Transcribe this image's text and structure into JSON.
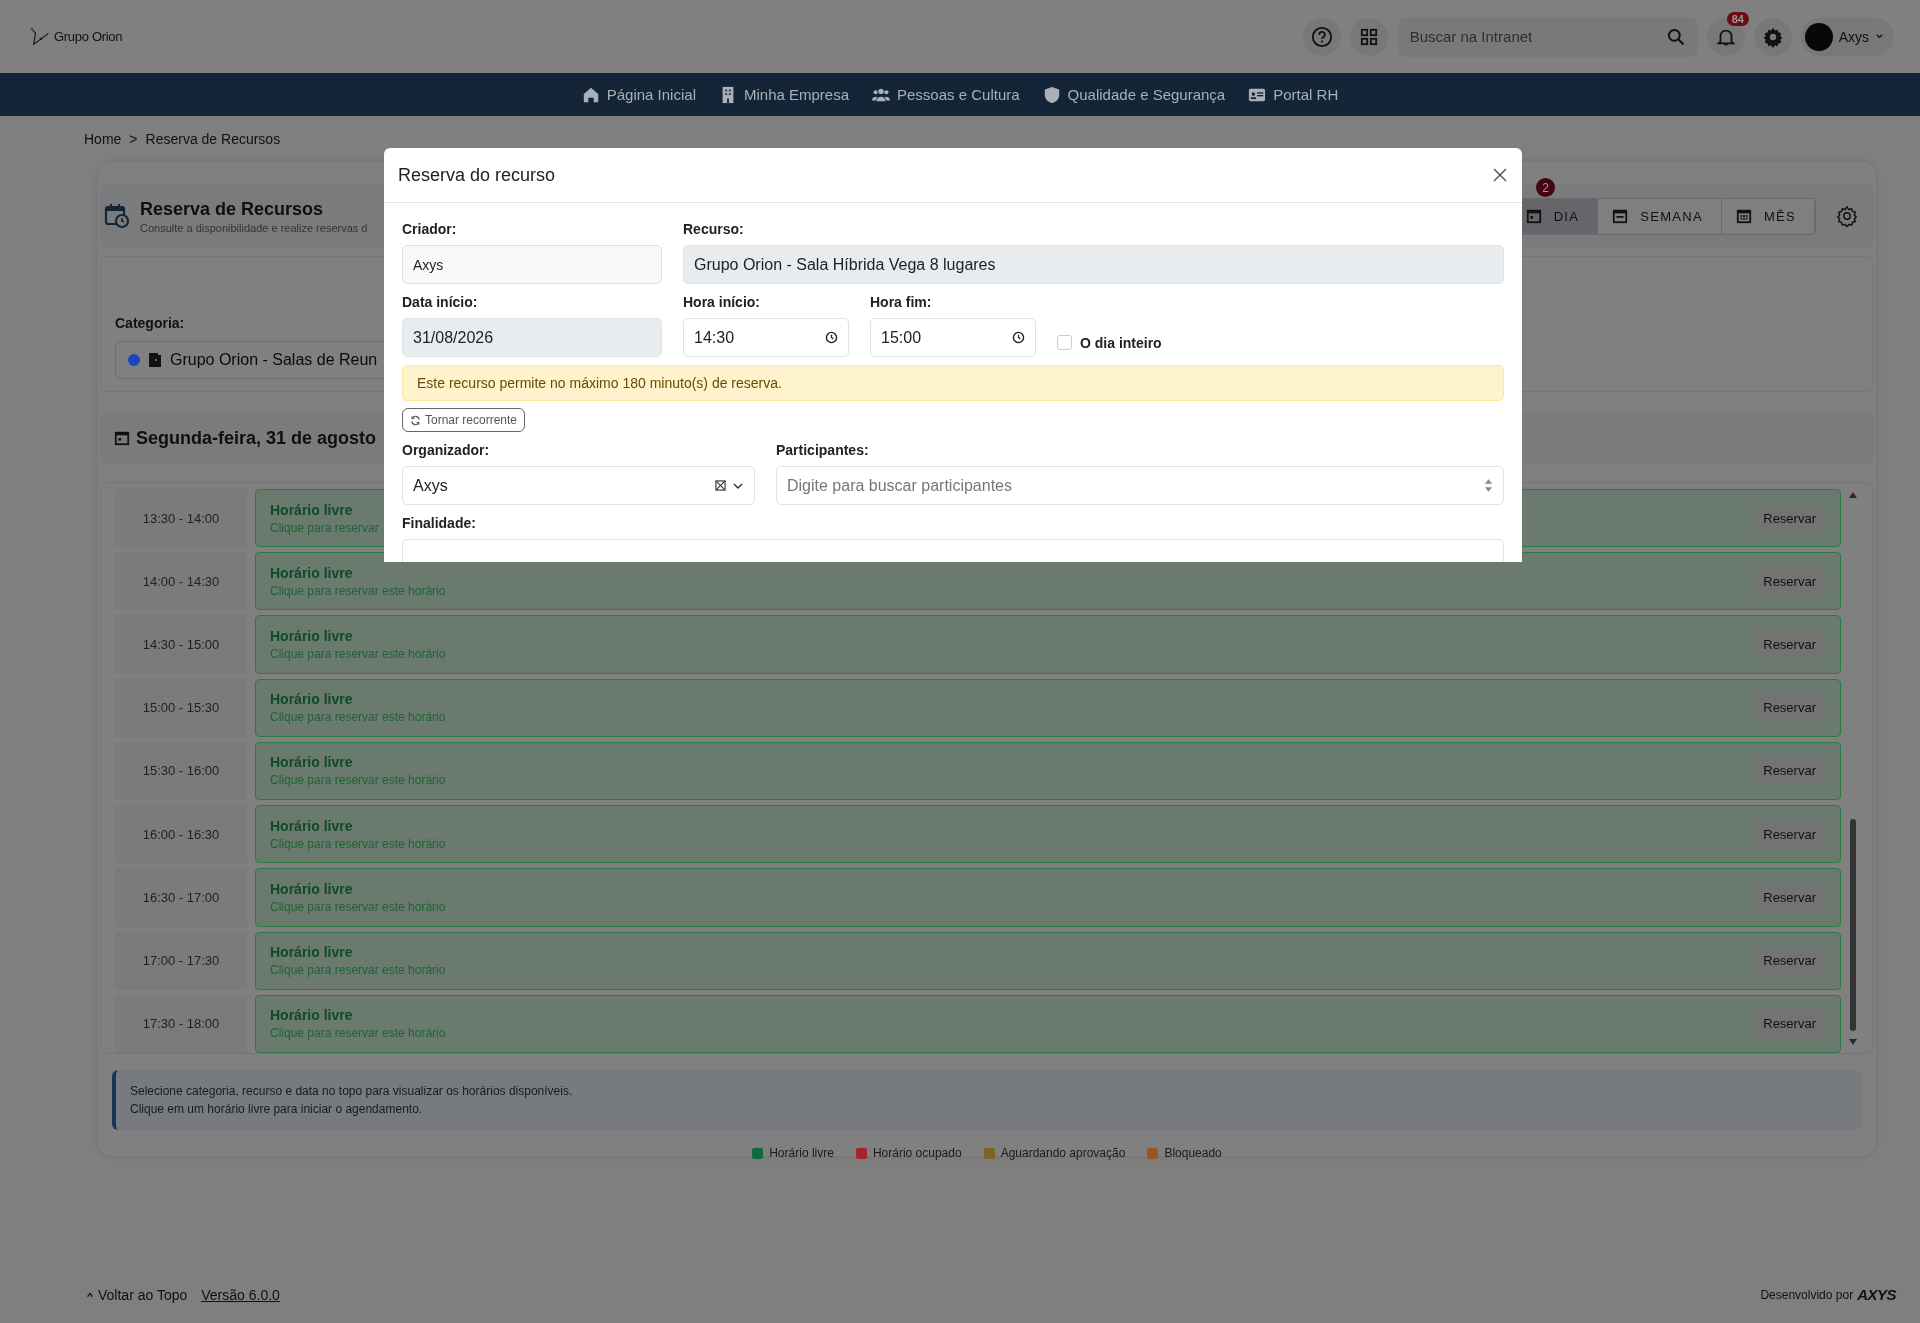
{
  "header": {
    "logo": "Grupo Orion",
    "search": {
      "placeholder": "Buscar na Intranet"
    },
    "notifications": "84",
    "user": "Axys"
  },
  "nav": [
    {
      "label": "Página Inicial"
    },
    {
      "label": "Minha Empresa"
    },
    {
      "label": "Pessoas e Cultura"
    },
    {
      "label": "Qualidade e Segurança"
    },
    {
      "label": "Portal RH"
    }
  ],
  "breadcrumb": {
    "items": [
      "Home",
      "Reserva de Recursos"
    ],
    "separator": ">"
  },
  "page": {
    "title": "Reserva de Recursos",
    "subtitle": "Consulte a disponibilidade e realize reservas d",
    "badge": "2",
    "views": [
      {
        "label": "DIA",
        "selected": true
      },
      {
        "label": "SEMANA",
        "selected": false
      },
      {
        "label": "MÊS",
        "selected": false
      }
    ],
    "category": {
      "label": "Categoria:",
      "value": "Grupo Orion - Salas de Reun",
      "color": "#1c47b8"
    },
    "date_heading": "Segunda-feira, 31 de agosto"
  },
  "slots": [
    {
      "time": "13:30 - 14:00",
      "title": "Horário livre",
      "hint": "Clique para reservar",
      "kind": "free",
      "action": "Reservar"
    },
    {
      "time": "14:00 - 14:30",
      "title": "Horário livre",
      "hint": "Clique para reservar este horário",
      "kind": "free",
      "action": "Reservar"
    },
    {
      "time": "14:30 - 15:00",
      "title": "Horário livre",
      "hint": "Clique para reservar este horário",
      "kind": "free",
      "action": "Reservar"
    },
    {
      "time": "15:00 - 15:30",
      "title": "Horário livre",
      "hint": "Clique para reservar este horário",
      "kind": "free",
      "action": "Reservar"
    },
    {
      "time": "15:30 - 16:00",
      "title": "Horário livre",
      "hint": "Clique para reservar este horário",
      "kind": "free",
      "action": "Reservar"
    },
    {
      "time": "16:00 - 16:30",
      "title": "Horário livre",
      "hint": "Clique para reservar este horário",
      "kind": "free",
      "action": "Reservar"
    },
    {
      "time": "16:30 - 17:00",
      "title": "Horário livre",
      "hint": "Clique para reservar este horário",
      "kind": "free",
      "action": "Reservar"
    },
    {
      "time": "17:00 - 17:30",
      "title": "Horário livre",
      "hint": "Clique para reservar este horário",
      "kind": "free",
      "action": "Reservar"
    },
    {
      "time": "17:30 - 18:00",
      "title": "Horário livre",
      "hint": "Clique para reservar este horário",
      "kind": "free",
      "action": "Reservar"
    }
  ],
  "info": [
    "Selecione categoria, recurso e data no topo para visualizar os horários disponíveis.",
    "Clique em um horário livre para iniciar o agendamento."
  ],
  "legend": [
    {
      "label": "Horário livre",
      "color": "#0c6b3c"
    },
    {
      "label": "Horário ocupado",
      "color": "#a3242d"
    },
    {
      "label": "Aguardando aprovação",
      "color": "#7c6523"
    },
    {
      "label": "Bloqueado",
      "color": "#9c5424"
    }
  ],
  "footer": {
    "back_to_top": "Voltar ao Topo",
    "version": "Versão 6.0.0",
    "credit": "Desenvolvido por",
    "brand": "AXYS"
  },
  "modal": {
    "title": "Reserva do recurso",
    "creator": {
      "label": "Criador:",
      "value": "Axys"
    },
    "resource": {
      "label": "Recurso:",
      "value": "Grupo Orion - Sala Híbrida Vega 8 lugares"
    },
    "start_date": {
      "label": "Data início:",
      "value": "31/08/2026"
    },
    "start_time": {
      "label": "Hora início:",
      "value": "14:30"
    },
    "end_time": {
      "label": "Hora fim:",
      "value": "15:00"
    },
    "all_day": {
      "label": "O dia inteiro",
      "checked": false
    },
    "alert": "Este recurso permite no máximo 180 minuto(s) de reserva.",
    "recurring_button": "Tornar recorrente",
    "organizer": {
      "label": "Organizador:",
      "value": "Axys"
    },
    "participants": {
      "label": "Participantes:",
      "placeholder": "Digite para buscar participantes"
    },
    "purpose": {
      "label": "Finalidade:"
    }
  }
}
